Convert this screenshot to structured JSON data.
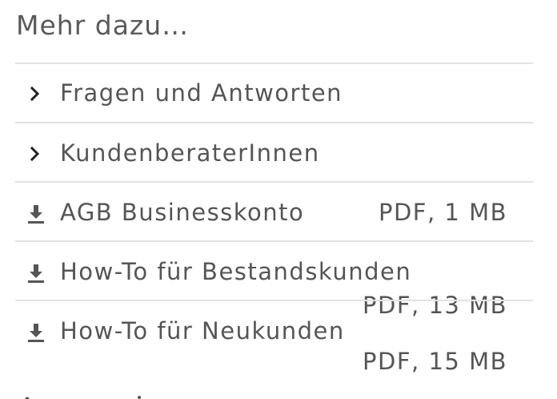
{
  "section": {
    "title": "Mehr dazu…"
  },
  "links": [
    {
      "icon": "chevron-right-icon",
      "label": "Fragen und Antworten"
    },
    {
      "icon": "chevron-right-icon",
      "label": "KundenberaterInnen"
    }
  ],
  "downloads": [
    {
      "icon": "download-icon",
      "label": "AGB Businesskonto",
      "meta": "PDF, 1 MB"
    },
    {
      "icon": "download-icon",
      "label": "How-To für Bestandskunden",
      "meta": "PDF, 13 MB"
    },
    {
      "icon": "download-icon",
      "label": "How-To für Neukunden",
      "meta": "PDF, 15 MB"
    }
  ],
  "colors": {
    "text": "#555555",
    "divider": "#e2e2e2",
    "background": "#ffffff"
  }
}
